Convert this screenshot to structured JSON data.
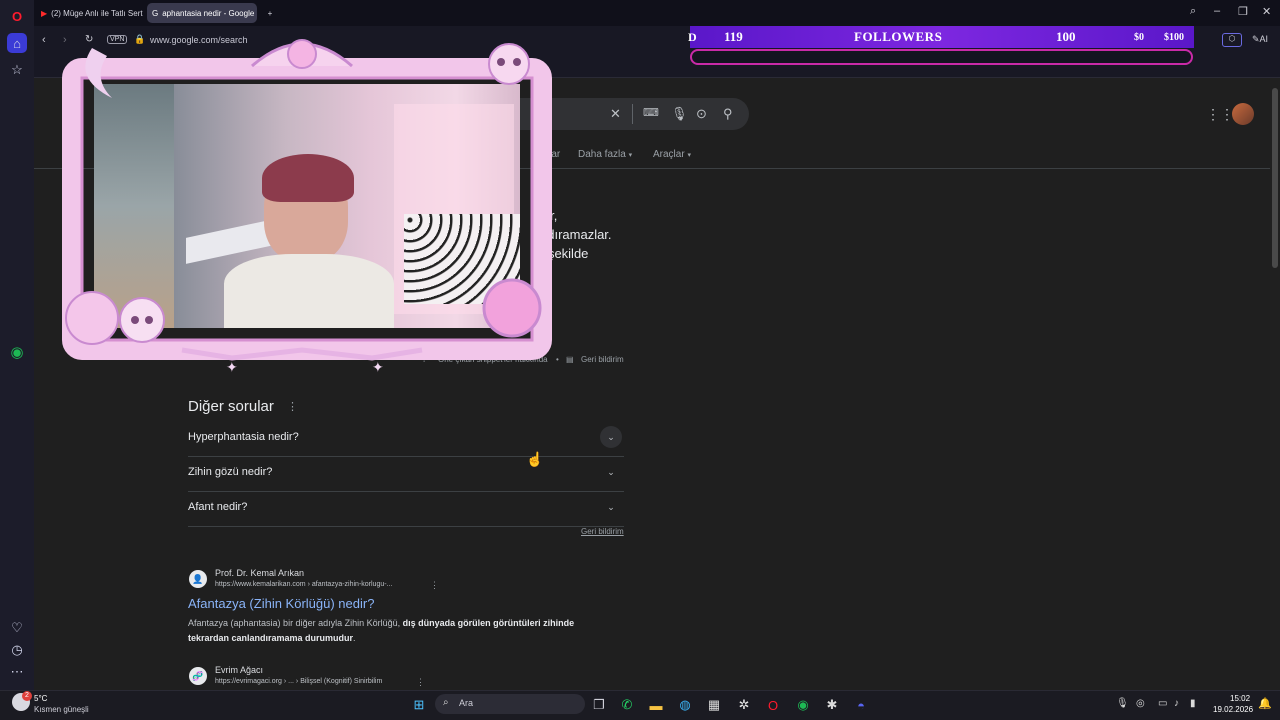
{
  "browser": {
    "tabs": [
      {
        "label": "(2) Müge Anlı ile Tatlı Sert",
        "active": false
      },
      {
        "label": "aphantasia nedir - Google",
        "active": true
      }
    ],
    "new_tab_label": "+",
    "vpn_badge": "VPN",
    "url": "www.google.com/search",
    "ai_label": "AI",
    "window_controls": [
      "search",
      "minimize",
      "maximize",
      "close"
    ]
  },
  "overlay": {
    "followers_current": "119",
    "followers_label": "FOLLOWERS",
    "followers_goal": "100",
    "donation_1": "$0",
    "donation_2": "$100",
    "followers_progress": 1.0,
    "accent_color": "#7d27e0",
    "bar_border_color": "#c92aa8"
  },
  "search": {
    "nav_tabs": [
      "eolar",
      "Daha fazla",
      "Araçlar"
    ]
  },
  "snippet": {
    "lines": [
      "r",
      "ler,",
      "ndıramazlar.",
      "r şekilde"
    ],
    "about_link": "Öne çıkan snippet'ler hakkında",
    "feedback": "Geri bildirim"
  },
  "paa": {
    "title": "Diğer sorular",
    "questions": [
      "Hyperphantasia nedir?",
      "Zihin gözü nedir?",
      "Afant nedir?"
    ],
    "feedback": "Geri bildirim"
  },
  "results": [
    {
      "site": "Prof. Dr. Kemal Arıkan",
      "url": "https://www.kemalarikan.com › afantazya-zihin-korlugu-...",
      "title": "Afantazya (Zihin Körlüğü) nedir?",
      "snippet_plain": "Afantazya (aphantasia) bir diğer adıyla Zihin Körlüğü, ",
      "snippet_bold": "dış dünyada görülen görüntüleri zihinde tekrardan canlandıramama durumudur",
      "snippet_end": "."
    },
    {
      "site": "Evrim Ağacı",
      "url": "https://evrimagaci.org › ... › Bilişsel (Kognitif) Sinirbilim"
    }
  ],
  "taskbar": {
    "weather_temp": "5°C",
    "weather_desc": "Kısmen güneşli",
    "search_placeholder": "Ara",
    "time": "15:02",
    "date": "19.02.2026",
    "badge_count": "2"
  }
}
